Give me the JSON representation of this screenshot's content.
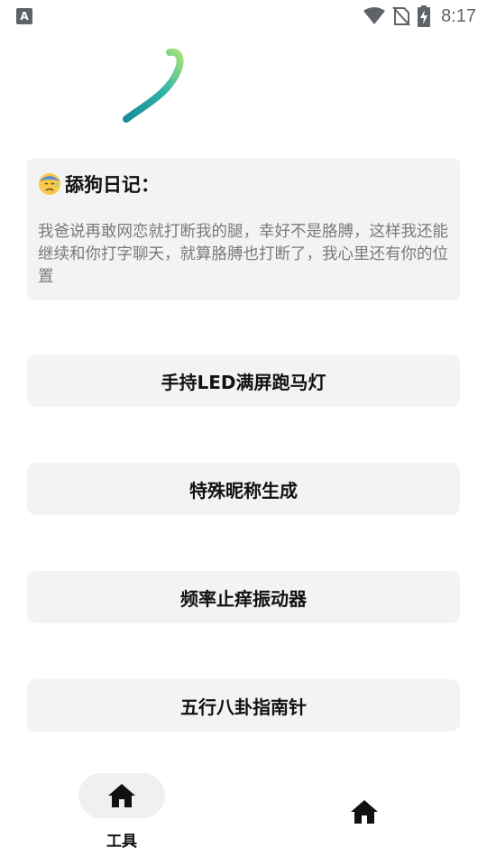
{
  "status_bar": {
    "app_badge": "A",
    "time": "8:17"
  },
  "diary": {
    "title": "舔狗日记：",
    "emoji_icon": "sweat-face-emoji",
    "text": "我爸说再敢网恋就打断我的腿，幸好不是胳膊，这样我还能继续和你打字聊天，就算胳膊也打断了，我心里还有你的位置"
  },
  "tools": [
    {
      "label": "手持LED满屏跑马灯"
    },
    {
      "label": "特殊昵称生成"
    },
    {
      "label": "频率止痒振动器"
    },
    {
      "label": "五行八卦指南针"
    }
  ],
  "bottom_nav": {
    "items": [
      {
        "label": "工具",
        "icon": "home-icon",
        "selected": true
      },
      {
        "label": "",
        "icon": "home-icon",
        "selected": false
      }
    ]
  },
  "colors": {
    "card_background": "#f3f3f3",
    "text_primary": "#111111",
    "text_secondary": "#7a7a7a",
    "status_icons": "#5f6368"
  }
}
